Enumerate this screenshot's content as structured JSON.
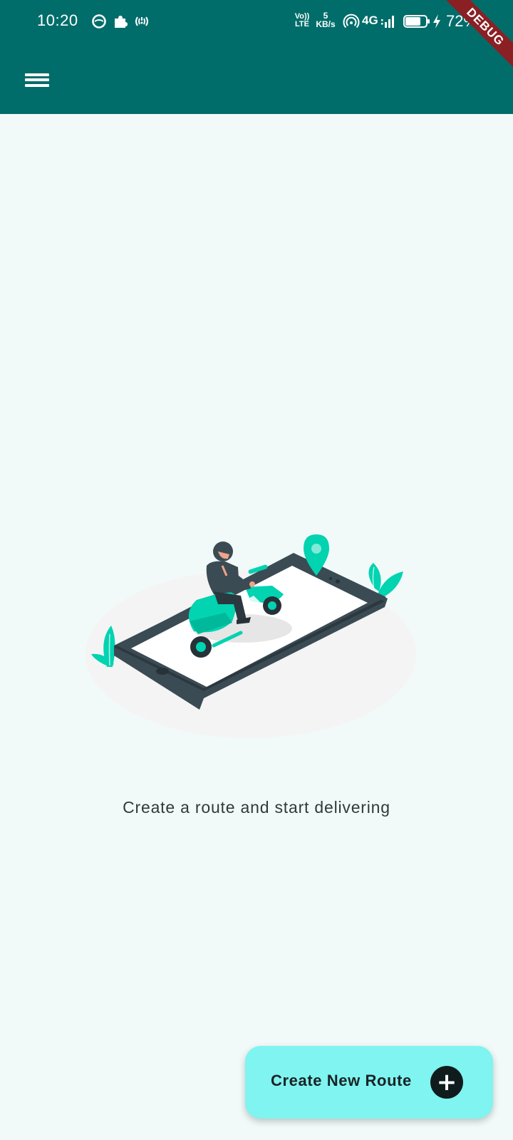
{
  "status_bar": {
    "time": "10:20",
    "volte_top": "Vo))",
    "volte_bottom": "LTE",
    "net_speed_value": "5",
    "net_speed_unit": "KB/s",
    "network": "4G",
    "battery_percent": "72%",
    "icons": [
      "messenger-icon",
      "puzzle-icon",
      "radio-icon",
      "hotspot-icon",
      "signal-icon",
      "battery-icon",
      "charging-bolt-icon"
    ]
  },
  "debug_banner": {
    "label": "DEBUG"
  },
  "app_bar": {
    "menu_icon": "hamburger-menu-icon",
    "background": "#006d6a"
  },
  "main": {
    "illustration": "delivery-scooter-on-phone-illustration",
    "empty_message": "Create a route and start delivering"
  },
  "fab": {
    "label": "Create New Route",
    "icon": "plus-circle-icon",
    "background": "#7ff4f0"
  },
  "colors": {
    "primary": "#006d6a",
    "page_background": "#f1faf9",
    "accent": "#02d3b1",
    "fab": "#7ff4f0",
    "debug": "#8a1f24"
  }
}
